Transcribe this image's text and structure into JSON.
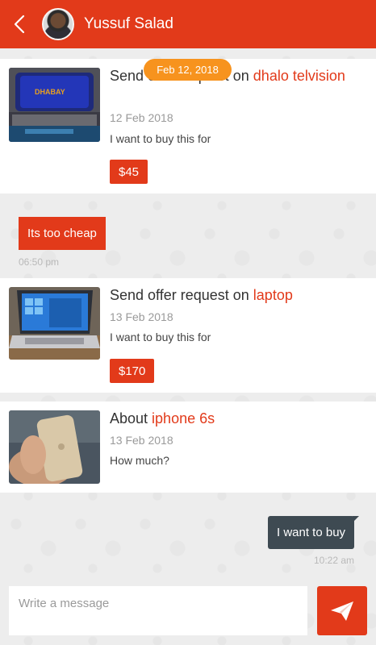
{
  "header": {
    "contact_name": "Yussuf Salad"
  },
  "date_badge": "Feb 12, 2018",
  "cards": [
    {
      "title_prefix": "Send offer request on ",
      "title_item": "dhalo telvision",
      "date": "12 Feb 2018",
      "message": "I want to buy this for",
      "price": "$45"
    },
    {
      "title_prefix": "Send offer request on ",
      "title_item": "laptop",
      "date": "13 Feb 2018",
      "message": "I want to buy this for",
      "price": "$170"
    },
    {
      "title_prefix": "About ",
      "title_item": "iphone 6s",
      "date": "13 Feb 2018",
      "message": "How much?"
    }
  ],
  "incoming": {
    "text": "Its too cheap",
    "time": "06:50 pm"
  },
  "outgoing": {
    "text": "I want to buy",
    "time": "10:22 am"
  },
  "composer": {
    "placeholder": "Write a message"
  },
  "colors": {
    "accent": "#e23a1a",
    "badge": "#f7931e",
    "outgoing_bubble": "#3e4a52"
  },
  "icons": {
    "back": "chevron-left-icon",
    "send": "paper-plane-icon"
  }
}
